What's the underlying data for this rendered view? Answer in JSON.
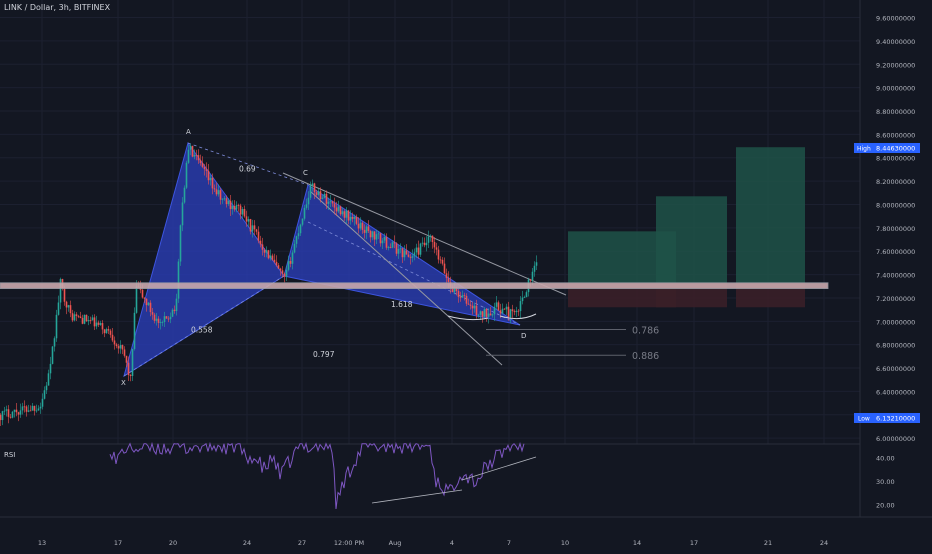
{
  "header": {
    "title": "LINK / Dollar, 3h, BITFINEX"
  },
  "rsi_panel": {
    "label": "RSI",
    "ticks": [
      "40.00",
      "30.00",
      "20.00"
    ]
  },
  "price_axis": {
    "ticks": [
      "9.60000000",
      "9.40000000",
      "9.20000000",
      "9.00000000",
      "8.80000000",
      "8.60000000",
      "8.40000000",
      "8.20000000",
      "8.00000000",
      "7.80000000",
      "7.60000000",
      "7.40000000",
      "7.20000000",
      "7.00000000",
      "6.80000000",
      "6.60000000",
      "6.40000000",
      "6.20000000",
      "6.00000000"
    ],
    "high_label": "High",
    "high_value": "8.44630000",
    "low_label": "Low",
    "low_value": "6.13210000"
  },
  "time_axis": {
    "ticks": [
      "13",
      "17",
      "20",
      "24",
      "27",
      "12:00 PM",
      "Aug",
      "4",
      "7",
      "10",
      "14",
      "17",
      "21",
      "24"
    ]
  },
  "pattern": {
    "point_labels": [
      "X",
      "A",
      "C",
      "D"
    ],
    "ratios": [
      {
        "text": "0.69",
        "price": 8.31
      },
      {
        "text": "0.558",
        "price": 6.93
      },
      {
        "text": "0.797",
        "price": 6.72
      },
      {
        "text": "1.618",
        "price": 7.15
      }
    ],
    "fib_levels": [
      {
        "text": "0.786",
        "price": 6.93
      },
      {
        "text": "0.886",
        "price": 6.71
      }
    ]
  },
  "chart_data": {
    "type": "candlestick",
    "title": "LINK / Dollar, 3h, BITFINEX",
    "ylim": [
      5.95,
      9.75
    ],
    "xlim_bars": [
      0,
      466
    ],
    "support_zone": [
      7.28,
      7.33
    ],
    "target_zones": [
      {
        "entry": 7.33,
        "target": 7.77,
        "stop": 7.12
      },
      {
        "entry": 7.33,
        "target": 8.07,
        "stop": 7.12
      },
      {
        "entry": 7.33,
        "target": 8.49,
        "stop": 7.12
      }
    ],
    "harmonic_points": {
      "X": {
        "bar": 65,
        "price": 6.5
      },
      "A": {
        "bar": 94,
        "price": 8.49
      },
      "B": {
        "bar": 142,
        "price": 7.35
      },
      "C": {
        "bar": 155,
        "price": 8.15
      },
      "D": {
        "bar": 261,
        "price": 6.92
      }
    },
    "rsi_range": [
      15,
      45
    ],
    "rsi_levels": [
      40,
      30,
      20
    ]
  }
}
